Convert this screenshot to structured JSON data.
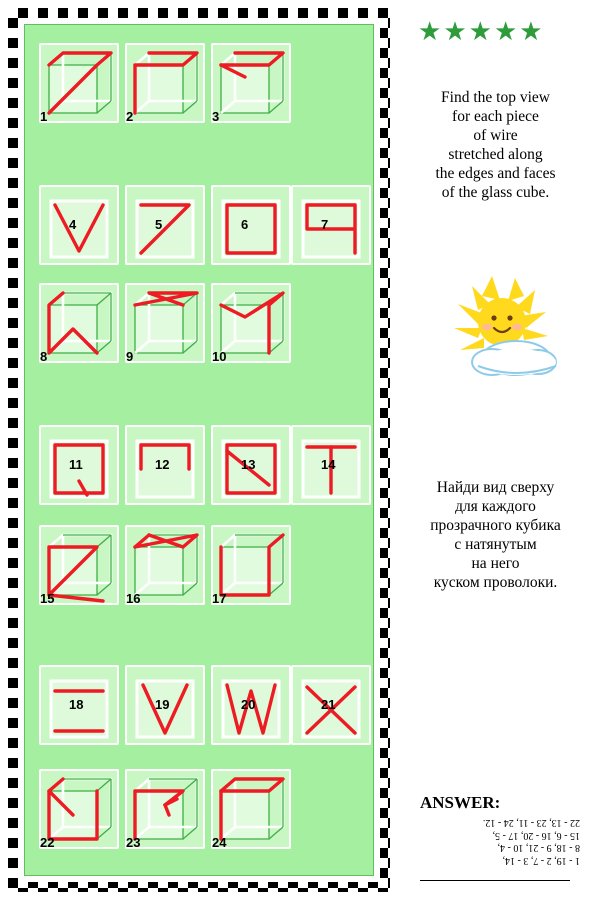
{
  "meta": {
    "stars": [
      "★",
      "★",
      "★",
      "★",
      "★"
    ],
    "star_color": "#2e9c3a"
  },
  "instructions": {
    "english": "Find the top view\nfor each piece\nof wire\nstretched along\nthe edges and faces\nof the glass cube.",
    "russian": "Найди вид сверху\nдля каждого\nпрозрачного кубика\nс натянутым\nна него\nкуском проволоки."
  },
  "answer": {
    "label": "ANSWER:",
    "lines": [
      "1 - 19, 2 - 7, 3 - 14,",
      "8 - 18, 9 - 21, 10 - 4,",
      "15 - 6, 16 - 20, 17 - 5,",
      "22 - 13, 23 - 11, 24 - 12."
    ]
  },
  "puzzle": {
    "tiles": [
      {
        "n": "1",
        "type": "cube"
      },
      {
        "n": "2",
        "type": "cube"
      },
      {
        "n": "3",
        "type": "cube"
      },
      {
        "n": "4",
        "type": "flat"
      },
      {
        "n": "5",
        "type": "flat"
      },
      {
        "n": "6",
        "type": "flat"
      },
      {
        "n": "7",
        "type": "flat"
      },
      {
        "n": "8",
        "type": "cube"
      },
      {
        "n": "9",
        "type": "cube"
      },
      {
        "n": "10",
        "type": "cube"
      },
      {
        "n": "11",
        "type": "flat"
      },
      {
        "n": "12",
        "type": "flat"
      },
      {
        "n": "13",
        "type": "flat"
      },
      {
        "n": "14",
        "type": "flat"
      },
      {
        "n": "15",
        "type": "cube"
      },
      {
        "n": "16",
        "type": "cube"
      },
      {
        "n": "17",
        "type": "cube"
      },
      {
        "n": "18",
        "type": "flat"
      },
      {
        "n": "19",
        "type": "flat"
      },
      {
        "n": "20",
        "type": "flat"
      },
      {
        "n": "21",
        "type": "flat"
      },
      {
        "n": "22",
        "type": "cube"
      },
      {
        "n": "23",
        "type": "cube"
      },
      {
        "n": "24",
        "type": "cube"
      }
    ]
  },
  "colors": {
    "wire": "#ee1b24",
    "cube_edge": "#3fae45",
    "background": "#a4f0a0",
    "tile": "#c8f7c4",
    "sun_yellow": "#ffd91e",
    "cloud_blue": "#bfe3f7"
  },
  "sun": {
    "name": "smiling-sun-with-cloud"
  }
}
